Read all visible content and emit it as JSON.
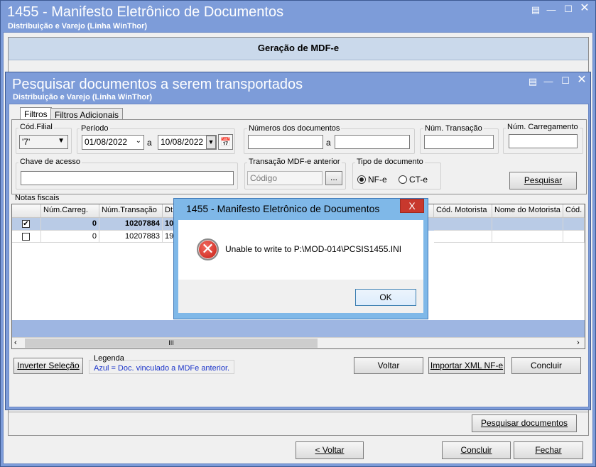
{
  "main_window": {
    "title": "1455 - Manifesto Eletrônico de Documentos",
    "subtitle": "Distribuição e Varejo (Linha WinThor)",
    "header": "Geração de MDF-e",
    "buttons": {
      "search_docs": "Pesquisar documentos",
      "back": "< Voltar",
      "finish": "Concluir",
      "close": "Fechar"
    }
  },
  "search_window": {
    "title": "Pesquisar documentos a serem transportados",
    "subtitle": "Distribuição e Varejo (Linha WinThor)",
    "tabs": [
      "Filtros",
      "Filtros Adicionais"
    ],
    "filters": {
      "cod_filial_label": "Cód.Filial",
      "cod_filial_value": "'7'",
      "periodo_label": "Período",
      "date_from": "01/08/2022",
      "a1": "a",
      "date_to": "10/08/2022",
      "num_docs_label": "Números dos documentos",
      "num_docs_from": "",
      "a2": "a",
      "num_docs_to": "",
      "num_transacao_label": "Núm. Transação",
      "num_transacao_value": "",
      "num_carregamento_label": "Núm. Carregamento",
      "num_carregamento_value": "",
      "chave_label": "Chave de acesso",
      "chave_value": "",
      "transacao_ant_label": "Transação MDF-e anterior",
      "transacao_ant_placeholder": "Código",
      "ellipsis": "...",
      "tipo_doc_label": "Tipo de documento",
      "nfe_label": "NF-e",
      "cte_label": "CT-e",
      "search_button": "Pesquisar"
    },
    "grid": {
      "label": "Notas fiscais",
      "columns": [
        "",
        "Núm.Carreg.",
        "Núm.Transação",
        "Dt",
        "Cód. Motorista",
        "Nome do Motorista",
        "Cód."
      ],
      "rows": [
        {
          "checked": "✔",
          "num_carreg": "0",
          "num_transacao": "10207884",
          "dt": "10"
        },
        {
          "checked": "",
          "num_carreg": "0",
          "num_transacao": "10207883",
          "dt": "19"
        }
      ],
      "scroll_thumb": "III"
    },
    "buttons": {
      "invert": "Inverter Seleção",
      "legend_title": "Legenda",
      "legend_text": "Azul = Doc. vinculado a MDFe anterior.",
      "back": "Voltar",
      "import_xml": "Importar XML NF-e",
      "finish": "Concluir"
    }
  },
  "dialog": {
    "title": "1455 - Manifesto Eletrônico de Documentos",
    "close": "X",
    "message": "Unable to write to P:\\MOD-014\\PCSIS1455.INI",
    "ok": "OK"
  },
  "colors": {
    "window_frame": "#7d9cd9",
    "grid_selected": "#b9cbe6",
    "dialog_frame": "#7fb8e8",
    "error_red": "#c41a10"
  }
}
